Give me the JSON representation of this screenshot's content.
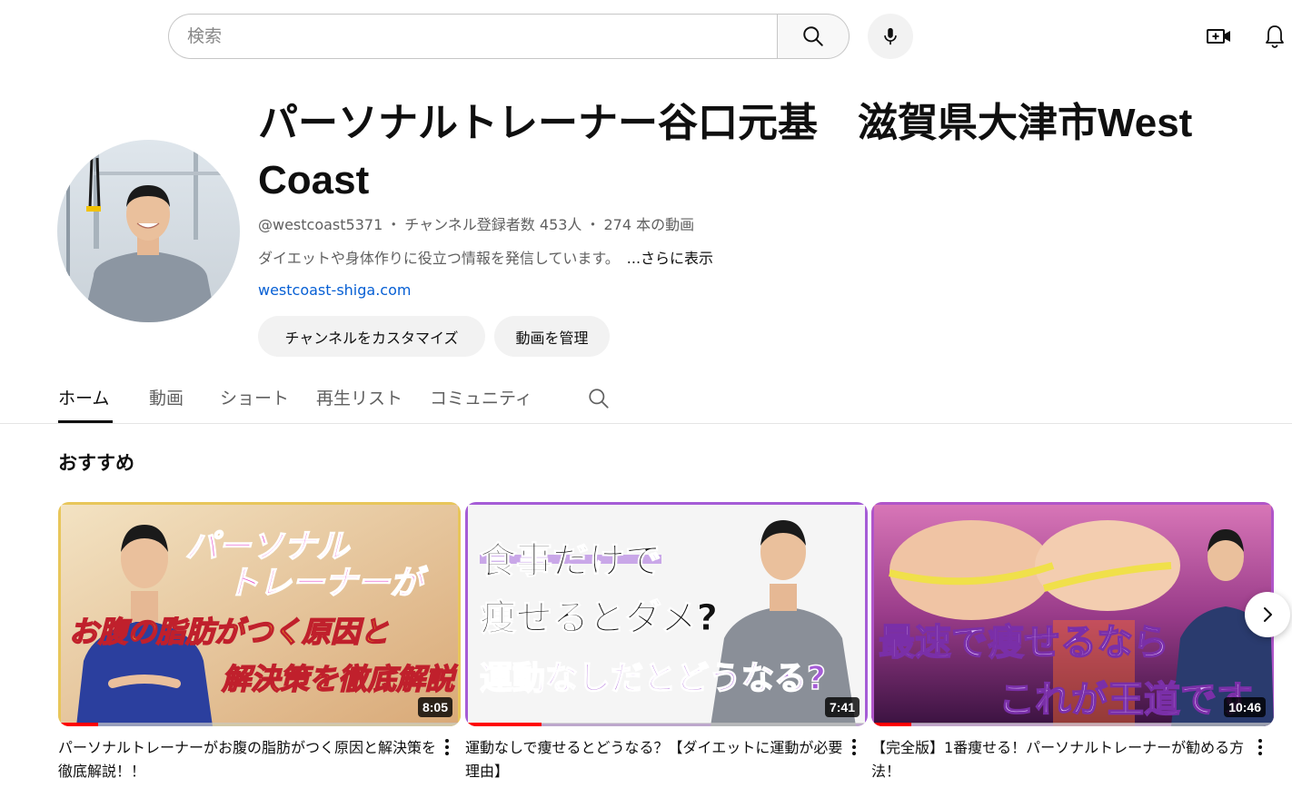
{
  "header": {
    "search_placeholder": "検索",
    "icons": {
      "search": "search-icon",
      "mic": "microphone-icon",
      "create": "create-video-icon",
      "notifications": "bell-icon"
    }
  },
  "channel": {
    "title": "パーソナルトレーナー谷口元基　滋賀県大津市West Coast",
    "handle": "@westcoast5371",
    "separator": "・",
    "subscribers": "チャンネル登録者数 453人",
    "videos": "274 本の動画",
    "description": "ダイエットや身体作りに役立つ情報を発信しています。",
    "more_label": "...さらに表示",
    "link": "westcoast-shiga.com",
    "customize_button": "チャンネルをカスタマイズ",
    "manage_button": "動画を管理"
  },
  "tabs": [
    {
      "label": "ホーム",
      "active": true
    },
    {
      "label": "動画",
      "active": false
    },
    {
      "label": "ショート",
      "active": false
    },
    {
      "label": "再生リスト",
      "active": false
    },
    {
      "label": "コミュニティ",
      "active": false
    }
  ],
  "section": {
    "title": "おすすめ"
  },
  "videos": [
    {
      "title": "パーソナルトレーナーがお腹の脂肪がつく原因と解決策を徹底解説！！",
      "duration": "8:05",
      "watched_fraction": 0.1,
      "thumb_lines": [
        "パーソナル",
        "トレーナーが",
        "お腹の脂肪がつく原因と",
        "解決策を徹底解説"
      ]
    },
    {
      "title": "運動なしで痩せるとどうなる？【ダイエットに運動が必要理由】",
      "duration": "7:41",
      "watched_fraction": 0.19,
      "thumb_lines": [
        "食事だけで",
        "痩せるとダメ?",
        "運動なしだとどうなる?"
      ]
    },
    {
      "title": "【完全版】1番痩せる！パーソナルトレーナーが勧める方法！",
      "duration": "10:46",
      "watched_fraction": 0.1,
      "thumb_lines": [
        "最速で痩せるなら",
        "これが王道です"
      ]
    }
  ],
  "colors": {
    "link": "#065fd4",
    "progress": "#ff0000",
    "secondary_text": "#606060"
  }
}
